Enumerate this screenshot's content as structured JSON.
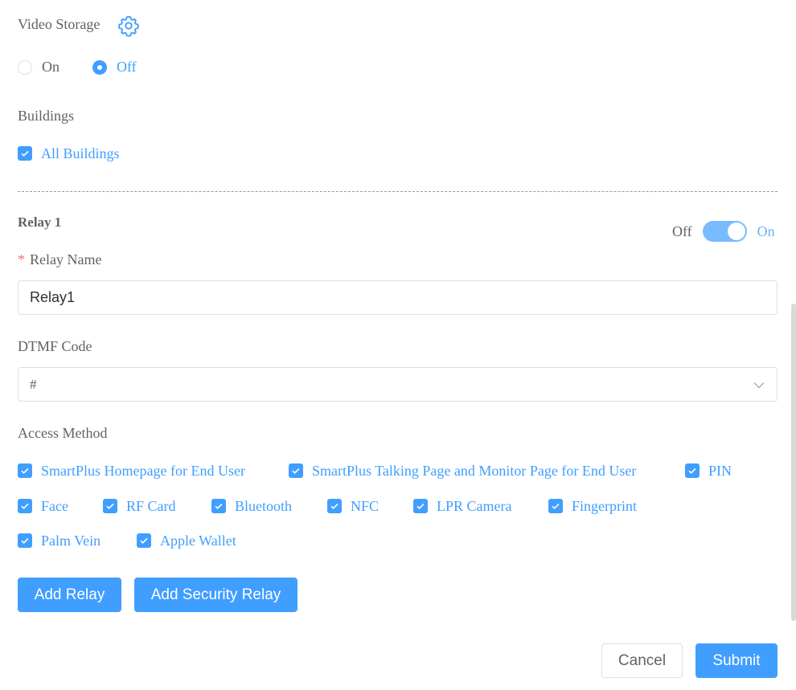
{
  "video_storage": {
    "label": "Video Storage",
    "settings_icon": "gear-icon",
    "options": [
      {
        "label": "On",
        "checked": false
      },
      {
        "label": "Off",
        "checked": true
      }
    ]
  },
  "buildings": {
    "label": "Buildings",
    "all_buildings": {
      "label": "All Buildings",
      "checked": true
    }
  },
  "relay": {
    "title": "Relay 1",
    "switch": {
      "off_label": "Off",
      "on_label": "On",
      "state": "on"
    },
    "name_field": {
      "required_mark": "*",
      "label": "Relay Name",
      "value": "Relay1"
    },
    "dtmf_field": {
      "label": "DTMF Code",
      "value": "#"
    },
    "access_method": {
      "label": "Access Method",
      "options": [
        {
          "label": "SmartPlus Homepage for End User",
          "checked": true
        },
        {
          "label": "SmartPlus Talking Page and Monitor Page for End User",
          "checked": true
        },
        {
          "label": "PIN",
          "checked": true
        },
        {
          "label": "Face",
          "checked": true
        },
        {
          "label": "RF Card",
          "checked": true
        },
        {
          "label": "Bluetooth",
          "checked": true
        },
        {
          "label": "NFC",
          "checked": true
        },
        {
          "label": "LPR Camera",
          "checked": true
        },
        {
          "label": "Fingerprint",
          "checked": true
        },
        {
          "label": "Palm Vein",
          "checked": true
        },
        {
          "label": "Apple Wallet",
          "checked": true
        }
      ]
    }
  },
  "buttons": {
    "add_relay": "Add Relay",
    "add_security_relay": "Add Security Relay",
    "cancel": "Cancel",
    "submit": "Submit"
  },
  "colors": {
    "accent": "#409eff",
    "text": "#606266",
    "required": "#f56c6c"
  }
}
